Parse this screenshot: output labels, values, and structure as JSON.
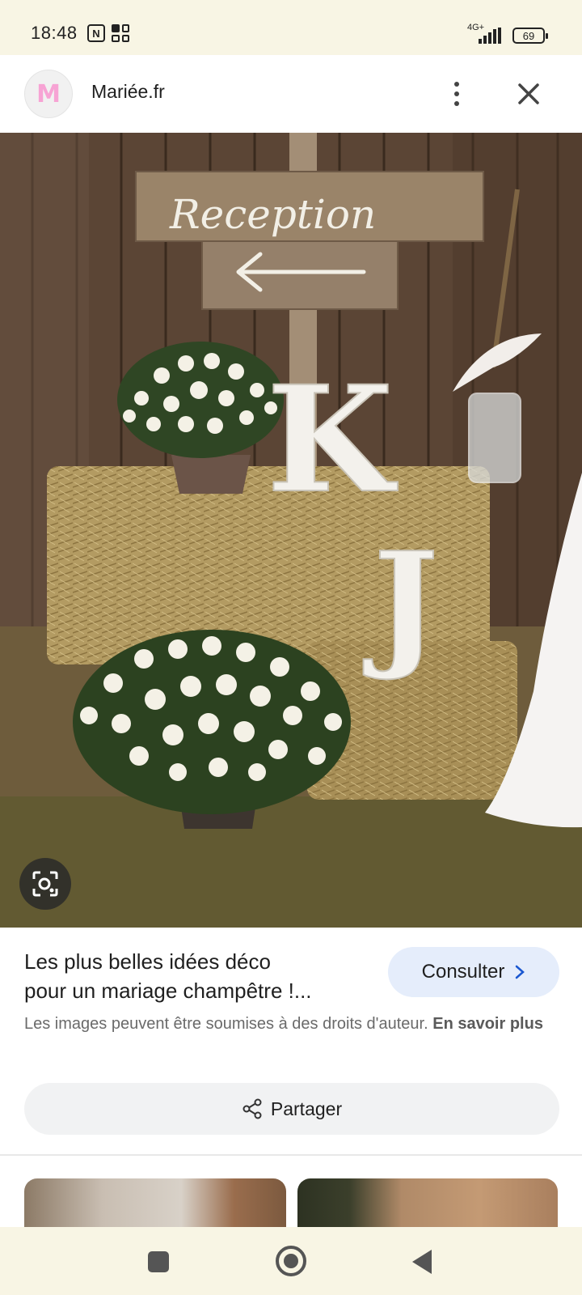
{
  "status_bar": {
    "time": "18:48",
    "network": "4G+",
    "battery": "69",
    "icons": [
      "nfc-icon",
      "grid-icon",
      "signal-icon",
      "battery-icon"
    ]
  },
  "header": {
    "logo_letter": "M",
    "site_name": "Mariée.fr",
    "icons": [
      "more-vert-icon",
      "close-icon"
    ]
  },
  "image": {
    "sign_text": "Reception",
    "letters": [
      "K",
      "J"
    ],
    "lens_icon": "lens-search-icon"
  },
  "info": {
    "title_line1": "Les plus belles idées déco",
    "title_line2": "pour un mariage champêtre !...",
    "visit_label": "Consulter",
    "copyright_text": "Les images peuvent être soumises à des droits d'auteur.",
    "learn_more": "En savoir plus"
  },
  "share": {
    "label": "Partager",
    "icon": "share-icon"
  },
  "nav": {
    "icons": [
      "recents-icon",
      "home-icon",
      "back-icon"
    ]
  },
  "colors": {
    "system_bar": "#f8f5e4",
    "visit_button_bg": "#e5edfb",
    "share_button_bg": "#f1f2f3",
    "logo_pink": "#f7a3d4"
  }
}
